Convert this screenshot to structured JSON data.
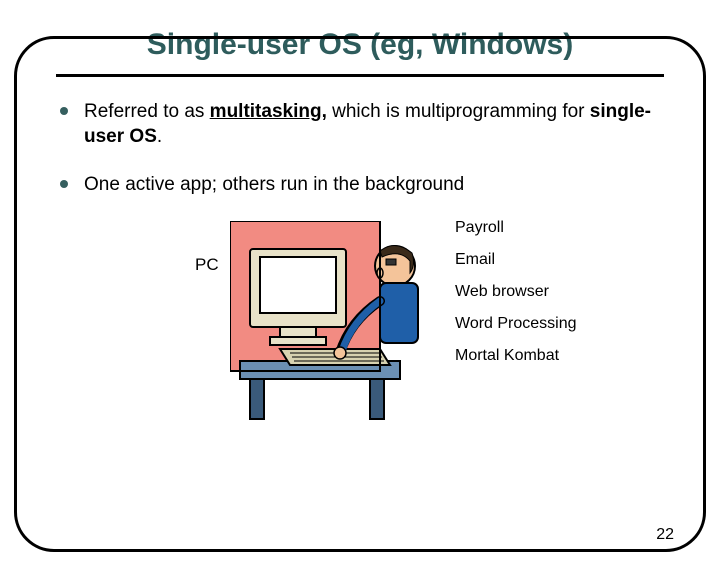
{
  "title": "Single-user OS   (eg, Windows)",
  "bullets": [
    {
      "pre": "Referred to as ",
      "emph": "multitasking,",
      "mid": "  which is multiprogramming for ",
      "bold": "single-user OS",
      "post": "."
    },
    {
      "text": "One active app; others run in the background"
    }
  ],
  "pc_label": "PC",
  "tasks": [
    "Payroll",
    "Email",
    "Web browser",
    "Word Processing",
    "Mortal Kombat"
  ],
  "page_number": "22"
}
